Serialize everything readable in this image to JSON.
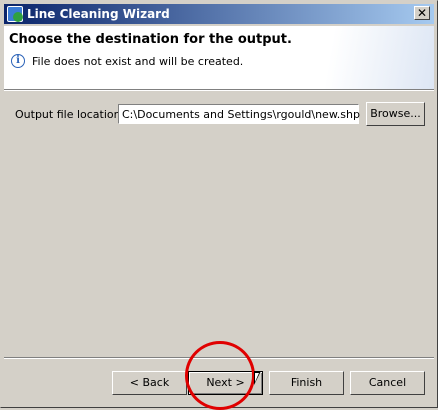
{
  "window": {
    "title": "Line Cleaning Wizard",
    "close_label": "✕"
  },
  "header": {
    "title": "Choose the destination for the output.",
    "message": "File does not exist and will be created.",
    "info_icon": "i"
  },
  "form": {
    "label": "Output file location:",
    "value": "C:\\Documents and Settings\\rgould\\new.shp",
    "browse": "Browse..."
  },
  "buttons": {
    "back": "< Back",
    "next": "Next >",
    "finish": "Finish",
    "cancel": "Cancel"
  },
  "annotation": {
    "highlight_color": "#e00000"
  }
}
